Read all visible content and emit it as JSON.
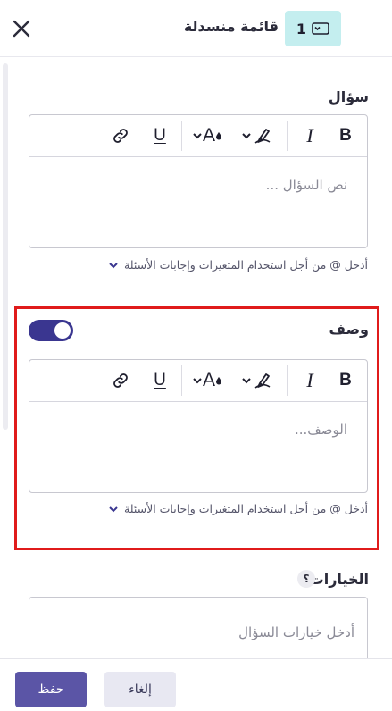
{
  "header": {
    "title": "قائمة منسدلة",
    "badge_number": "1",
    "badge_icon": "dropdown-icon",
    "close_icon": "close-icon"
  },
  "question": {
    "label": "سؤال",
    "placeholder": "نص السؤال ...",
    "hint": "أدخل @ من أجل استخدام المتغيرات وإجابات الأسئلة"
  },
  "description": {
    "label": "وصف",
    "toggle_on": true,
    "placeholder": "الوصف...",
    "hint": "أدخل @ من أجل استخدام المتغيرات وإجابات الأسئلة"
  },
  "toolbar": {
    "bold": "B",
    "italic": "I",
    "underline": "U",
    "font_color": "A",
    "highlight_icon": "highlighter-icon",
    "link_icon": "link-icon"
  },
  "choices": {
    "label": "الخيارات",
    "help": "؟",
    "placeholder": "أدخل خيارات السؤال"
  },
  "footer": {
    "save_label": "حفظ",
    "cancel_label": "إلغاء"
  },
  "colors": {
    "accent": "#5b55a6",
    "toggle": "#3a3690",
    "badge": "#c4eeef",
    "highlight_border": "#e01b1b"
  }
}
